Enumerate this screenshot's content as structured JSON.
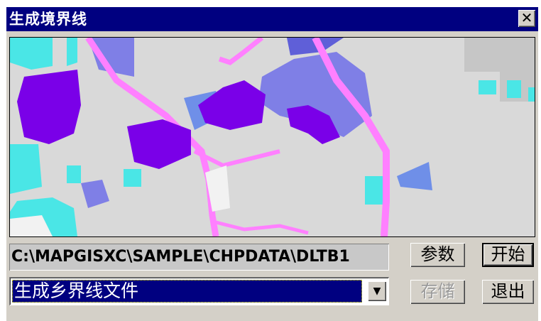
{
  "window": {
    "title": "生成境界线",
    "close_label": "✕"
  },
  "map": {
    "colors": {
      "background": "#d9d9d9",
      "residential": "#7a00e8",
      "water": "#4ae6e6",
      "forest": "#7f7fe6",
      "road": "#ff80ff",
      "blank": "#f2f2f2"
    }
  },
  "path_field": {
    "value": "C:\\MAPGISXC\\SAMPLE\\CHPDATA\\DLTB1"
  },
  "combo": {
    "selected": "生成乡界线文件"
  },
  "buttons": {
    "params": "参数",
    "start": "开始",
    "save": "存储",
    "exit": "退出"
  }
}
